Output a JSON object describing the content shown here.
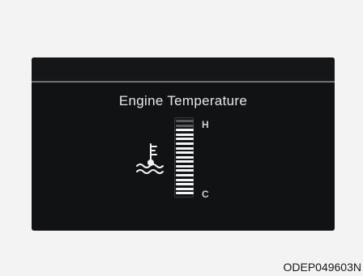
{
  "display": {
    "title": "Engine Temperature",
    "high_label": "H",
    "low_label": "C"
  },
  "gauge": {
    "total_segments": 17,
    "lit_segments": 15
  },
  "icons": {
    "temperature": "coolant-temperature-icon"
  },
  "colors": {
    "screen_background": "#111214",
    "text": "#e8e8e8",
    "segment_lit": "#f4f4f4",
    "segment_dim": "#5a5b5e",
    "page_background": "#f3f3f3"
  },
  "figure": {
    "code": "ODEP049603N"
  }
}
